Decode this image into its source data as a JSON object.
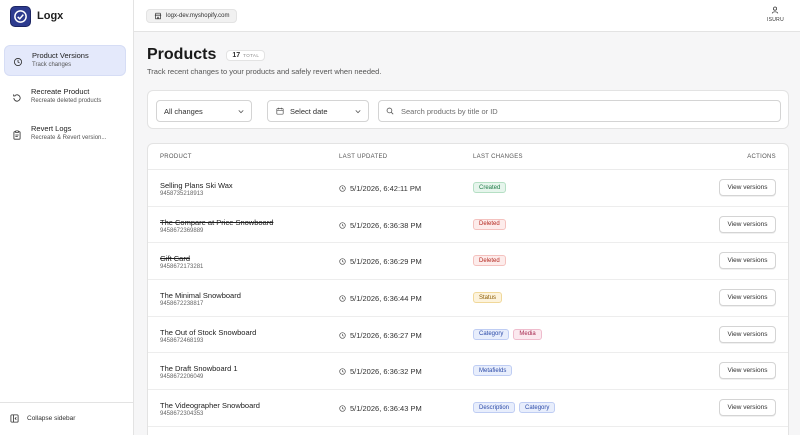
{
  "app": {
    "name": "Logx"
  },
  "sidebar": {
    "items": [
      {
        "label": "Product Versions",
        "sub": "Track changes",
        "icon": "history-icon",
        "active": true
      },
      {
        "label": "Recreate Product",
        "sub": "Recreate deleted products",
        "icon": "restore-icon",
        "active": false
      },
      {
        "label": "Revert Logs",
        "sub": "Recreate & Revert version...",
        "icon": "clipboard-icon",
        "active": false
      }
    ],
    "collapse_label": "Collapse sidebar"
  },
  "topbar": {
    "store": "logx-dev.myshopify.com",
    "user": "ISURU"
  },
  "page": {
    "title": "Products",
    "total_count": "17",
    "total_label": "TOTAL",
    "subtitle": "Track recent changes to your products and safely revert when needed."
  },
  "filters": {
    "changes": "All changes",
    "date": "Select date",
    "search_placeholder": "Search products by title or ID"
  },
  "table": {
    "headers": {
      "product": "PRODUCT",
      "updated": "LAST UPDATED",
      "changes": "LAST CHANGES",
      "actions": "ACTIONS"
    },
    "action_label": "View versions",
    "rows": [
      {
        "name": "Selling Plans Ski Wax",
        "id": "9458735218913",
        "updated": "5/1/2026, 6:42:11 PM",
        "deleted": false,
        "tags": [
          {
            "label": "Created",
            "kind": "created"
          }
        ]
      },
      {
        "name": "The Compare at Price Snowboard",
        "id": "9458672369889",
        "updated": "5/1/2026, 6:36:38 PM",
        "deleted": true,
        "tags": [
          {
            "label": "Deleted",
            "kind": "deleted"
          }
        ]
      },
      {
        "name": "Gift Card",
        "id": "9458672173281",
        "updated": "5/1/2026, 6:36:29 PM",
        "deleted": true,
        "tags": [
          {
            "label": "Deleted",
            "kind": "deleted"
          }
        ]
      },
      {
        "name": "The Minimal Snowboard",
        "id": "9458672238817",
        "updated": "5/1/2026, 6:36:44 PM",
        "deleted": false,
        "tags": [
          {
            "label": "Status",
            "kind": "status"
          }
        ]
      },
      {
        "name": "The Out of Stock Snowboard",
        "id": "9458672468193",
        "updated": "5/1/2026, 6:36:27 PM",
        "deleted": false,
        "tags": [
          {
            "label": "Category",
            "kind": "category"
          },
          {
            "label": "Media",
            "kind": "media"
          }
        ]
      },
      {
        "name": "The Draft Snowboard 1",
        "id": "9458672206049",
        "updated": "5/1/2026, 6:36:32 PM",
        "deleted": false,
        "tags": [
          {
            "label": "Metafields",
            "kind": "metafields"
          }
        ]
      },
      {
        "name": "The Videographer Snowboard",
        "id": "9458672304353",
        "updated": "5/1/2026, 6:36:43 PM",
        "deleted": false,
        "tags": [
          {
            "label": "Description",
            "kind": "description"
          },
          {
            "label": "Category",
            "kind": "category"
          }
        ]
      }
    ]
  }
}
